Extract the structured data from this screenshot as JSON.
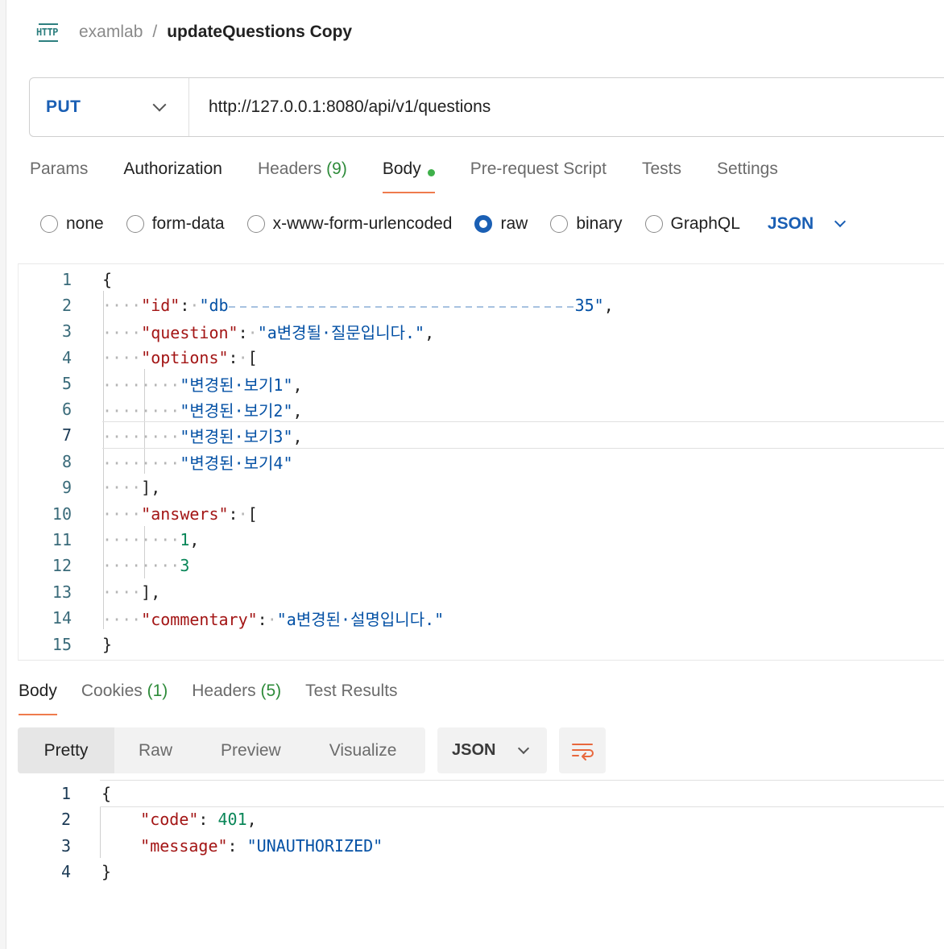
{
  "header": {
    "icon_text": "HTTP",
    "collection": "examlab",
    "separator": "/",
    "request_name": "updateQuestions Copy"
  },
  "request": {
    "method": "PUT",
    "url": "http://127.0.0.1:8080/api/v1/questions"
  },
  "request_tabs": [
    {
      "label": "Params"
    },
    {
      "label": "Authorization"
    },
    {
      "label": "Headers",
      "count": "(9)"
    },
    {
      "label": "Body",
      "active": true
    },
    {
      "label": "Pre-request Script"
    },
    {
      "label": "Tests"
    },
    {
      "label": "Settings"
    }
  ],
  "body_types": {
    "none": "none",
    "form_data": "form-data",
    "urlencoded": "x-www-form-urlencoded",
    "raw": "raw",
    "binary": "binary",
    "graphql": "GraphQL",
    "selected": "raw",
    "format": "JSON"
  },
  "request_body": {
    "line_numbers": [
      "1",
      "2",
      "3",
      "4",
      "5",
      "6",
      "7",
      "8",
      "9",
      "10",
      "11",
      "12",
      "13",
      "14",
      "15"
    ],
    "current_line": "7",
    "key_id": "\"id\"",
    "val_id_start": "\"db",
    "val_id_end": "35\"",
    "key_question": "\"question\"",
    "val_question": "\"a변경될·질문입니다.\"",
    "key_options": "\"options\"",
    "option1": "\"변경된·보기1\"",
    "option2": "\"변경된·보기2\"",
    "option3": "\"변경된·보기3\"",
    "option4": "\"변경된·보기4\"",
    "key_answers": "\"answers\"",
    "answer1": "1",
    "answer2": "3",
    "key_commentary": "\"commentary\"",
    "val_commentary": "\"a변경된·설명입니다.\""
  },
  "response_tabs": {
    "body": "Body",
    "cookies": "Cookies",
    "cookies_count": "(1)",
    "headers": "Headers",
    "headers_count": "(5)",
    "test_results": "Test Results"
  },
  "response_view": {
    "pretty": "Pretty",
    "raw": "Raw",
    "preview": "Preview",
    "visualize": "Visualize",
    "format": "JSON"
  },
  "response_body": {
    "line_numbers": [
      "1",
      "2",
      "3",
      "4"
    ],
    "key_code": "\"code\"",
    "val_code": "401",
    "key_message": "\"message\"",
    "val_message": "\"UNAUTHORIZED\""
  },
  "colors": {
    "method": "#1a5fb4",
    "tab_underline": "#ef7b4d",
    "body_dot": "#3eb04a",
    "json_key": "#a31515",
    "json_string": "#0451a5",
    "json_number": "#098658"
  }
}
